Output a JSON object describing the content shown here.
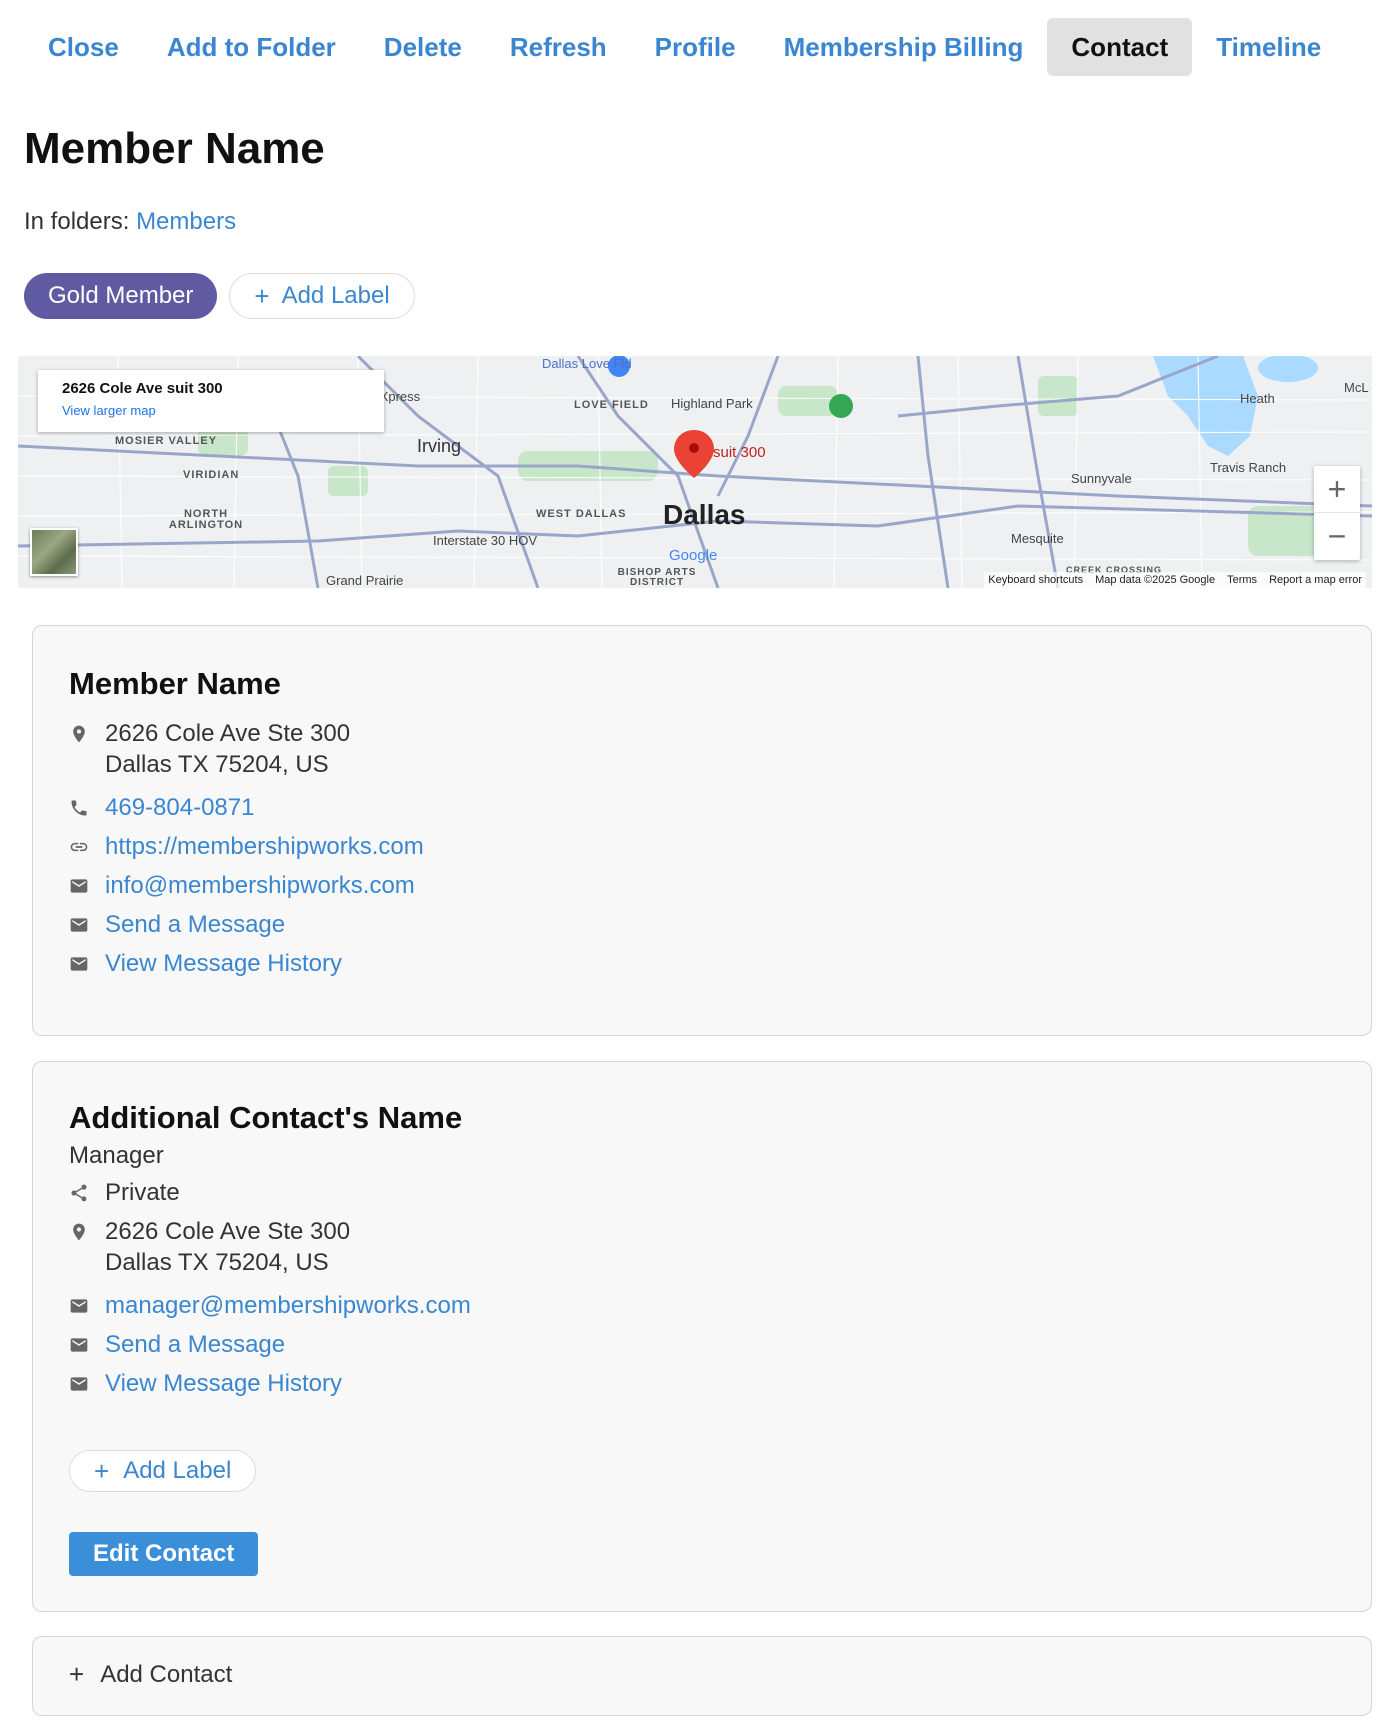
{
  "toolbar": {
    "items": [
      {
        "label": "Close"
      },
      {
        "label": "Add to Folder"
      },
      {
        "label": "Delete"
      },
      {
        "label": "Refresh"
      },
      {
        "label": "Profile"
      },
      {
        "label": "Membership Billing"
      },
      {
        "label": "Contact",
        "active": true
      },
      {
        "label": "Timeline"
      }
    ]
  },
  "member": {
    "name": "Member Name",
    "folders_prefix": "In folders:",
    "folder_link": "Members",
    "labels": {
      "gold": "Gold Member",
      "add": "Add Label"
    }
  },
  "map": {
    "info_address": "2626 Cole Ave suit 300",
    "info_link": "View larger map",
    "pin_label": "suit 300",
    "city": "Dallas",
    "place_labels": [
      "Irving",
      "Highland Park",
      "Heath",
      "Travis Ranch",
      "Sunnyvale",
      "Mesquite",
      "Grand Prairie",
      "Dallas Love Fld",
      "MOSIER VALLEY",
      "VIRIDIAN",
      "NORTH ARLINGTON",
      "WEST DALLAS",
      "LOVE FIELD",
      "BISHOP ARTS DISTRICT",
      "CREEK CROSSING",
      "McL",
      "EXpress",
      "Interstate 30 HOV",
      "Google"
    ],
    "footer": [
      "Keyboard shortcuts",
      "Map data ©2025 Google",
      "Terms",
      "Report a map error"
    ],
    "zoom_in": "+",
    "zoom_out": "−",
    "water_color": "#aadaff",
    "park_color": "#c8e6c9"
  },
  "contact_card": {
    "name": "Member Name",
    "address_line1": "2626 Cole Ave Ste 300",
    "address_line2": "Dallas TX 75204, US",
    "phone": "469-804-0871",
    "website": "https://membershipworks.com",
    "email": "info@membershipworks.com",
    "send_message": "Send a Message",
    "message_history": "View Message History"
  },
  "additional_contact": {
    "name": "Additional Contact's Name",
    "role": "Manager",
    "privacy": "Private",
    "address_line1": "2626 Cole Ave Ste 300",
    "address_line2": "Dallas TX 75204, US",
    "email": "manager@membershipworks.com",
    "send_message": "Send a Message",
    "message_history": "View Message History",
    "add_label": "Add Label",
    "edit_button": "Edit Contact"
  },
  "add_contact": {
    "label": "Add Contact"
  },
  "colors": {
    "link": "#3a86d0",
    "gold_pill": "#5f5aa2",
    "edit_button": "#3a8fd8",
    "active_tab_bg": "#e1e1e1"
  }
}
